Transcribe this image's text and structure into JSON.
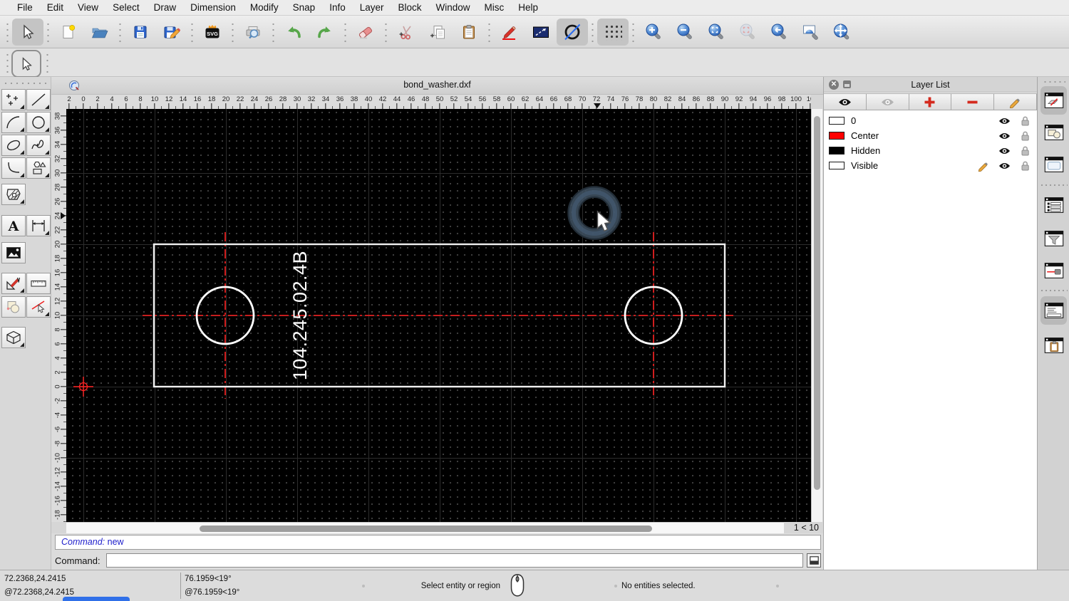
{
  "menu": {
    "items": [
      "File",
      "Edit",
      "View",
      "Select",
      "Draw",
      "Dimension",
      "Modify",
      "Snap",
      "Info",
      "Layer",
      "Block",
      "Window",
      "Misc",
      "Help"
    ]
  },
  "toolbar": {
    "svg_label": "SVG",
    "icons": [
      "select-arrow",
      "new-document",
      "open-folder",
      "save",
      "save-as",
      "svg-export",
      "print-preview",
      "undo",
      "redo",
      "delete",
      "cut",
      "copy",
      "paste",
      "pen-attributes",
      "line-attributes",
      "circle-slash",
      "grid-toggle",
      "zoom-in",
      "zoom-out",
      "zoom-auto",
      "zoom-select",
      "zoom-previous",
      "zoom-window",
      "zoom-pan"
    ]
  },
  "palette": {
    "text_tool_glyph": "A",
    "icons": [
      "points",
      "line",
      "arc",
      "circle",
      "ellipse",
      "spline",
      "polyline",
      "polygon-shapes",
      "hatch",
      "text",
      "dimension",
      "image",
      "modify",
      "measure",
      "order",
      "select-entity",
      "block"
    ]
  },
  "window": {
    "title": "bond_washer.dxf",
    "grid_indicator": "1 < 10"
  },
  "drawing": {
    "part_label": "104.245.02.4B"
  },
  "rulers": {
    "top_labels": [
      "2",
      "0",
      "2",
      "4",
      "6",
      "8",
      "10",
      "12",
      "14",
      "16",
      "18",
      "20",
      "22",
      "24",
      "26",
      "28",
      "30",
      "32",
      "34",
      "36",
      "38",
      "40",
      "42",
      "44",
      "46",
      "48",
      "50",
      "52",
      "54",
      "56",
      "58",
      "60",
      "62",
      "64",
      "66",
      "68",
      "70",
      "72",
      "74",
      "76",
      "78",
      "80",
      "82",
      "84",
      "86",
      "88",
      "90",
      "92",
      "94",
      "96",
      "98",
      "100",
      "10"
    ],
    "left_labels": [
      "38",
      "36",
      "34",
      "32",
      "30",
      "28",
      "26",
      "24",
      "22",
      "20",
      "18",
      "16",
      "14",
      "12",
      "10",
      "8",
      "6",
      "4",
      "2",
      "0",
      "-2",
      "-4",
      "-6",
      "-8",
      "-10",
      "-12",
      "-14",
      "-16",
      "-18"
    ]
  },
  "layer_panel": {
    "title": "Layer List",
    "layers": [
      {
        "name": "0",
        "color": "#ffffff",
        "current": false
      },
      {
        "name": "Center",
        "color": "#ff0000",
        "current": false
      },
      {
        "name": "Hidden",
        "color": "#000000",
        "current": false
      },
      {
        "name": "Visible",
        "color": "#ffffff",
        "current": true
      }
    ],
    "toolbar_icons": [
      "show-all-layers",
      "hide-all-layers",
      "add-layer",
      "remove-layer",
      "edit-layer"
    ]
  },
  "dock_strip": {
    "icons": [
      "layer-list-dock",
      "block-list-dock",
      "library-browser-dock",
      "entity-list-dock",
      "filter-dock",
      "laser-dock",
      "command-line-dock",
      "clipboard-dock"
    ],
    "active": [
      0,
      6
    ]
  },
  "command": {
    "history_label": "Command:",
    "history_value": "new",
    "prompt_label": "Command:",
    "input_value": "",
    "input_placeholder": ""
  },
  "status": {
    "abs_coord": "72.2368,24.2415",
    "rel_coord": "@72.2368,24.2415",
    "polar_coord": "76.1959<19°",
    "polar_rel_coord": "@76.1959<19°",
    "hint": "Select entity or region",
    "selection_status": "No entities selected."
  },
  "colors": {
    "canvas_bg": "#000000",
    "centerline_red": "#ff2020",
    "entity_white": "#f2f2f2",
    "layer_red": "#ff0000"
  }
}
